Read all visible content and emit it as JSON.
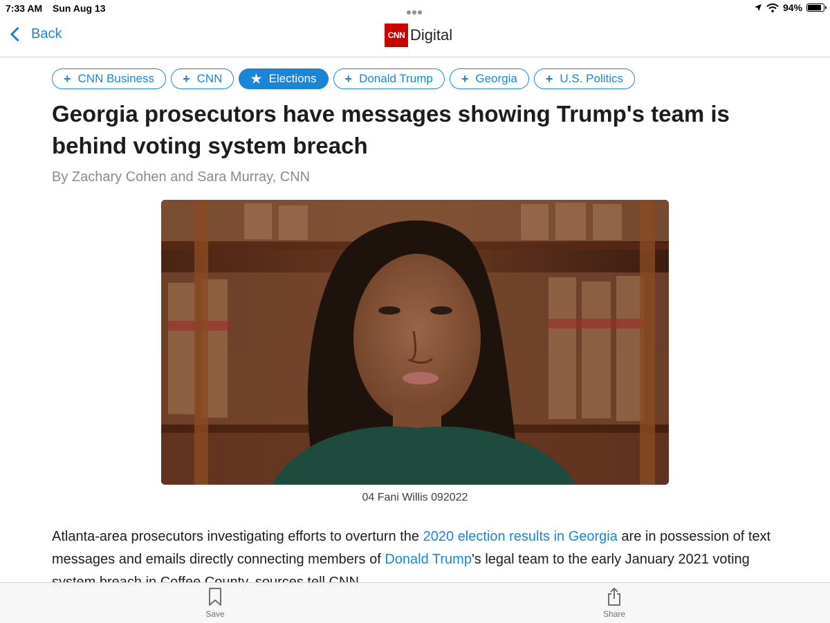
{
  "status_bar": {
    "time": "7:33 AM",
    "date": "Sun Aug 13",
    "battery": "94%",
    "battery_level": 0.94
  },
  "nav": {
    "back_label": "Back",
    "logo_mark": "CNN",
    "logo_text": "Digital"
  },
  "tags": [
    {
      "label": "CNN Business",
      "icon": "plus-icon",
      "active": false
    },
    {
      "label": "CNN",
      "icon": "plus-icon",
      "active": false
    },
    {
      "label": "Elections",
      "icon": "star-icon",
      "active": true
    },
    {
      "label": "Donald Trump",
      "icon": "plus-icon",
      "active": false
    },
    {
      "label": "Georgia",
      "icon": "plus-icon",
      "active": false
    },
    {
      "label": "U.S. Politics",
      "icon": "plus-icon",
      "active": false
    }
  ],
  "article": {
    "headline": "Georgia prosecutors have messages showing Trump's team is behind voting system breach",
    "byline": "By Zachary Cohen and Sara Murray, CNN",
    "photo_caption": "04 Fani Willis 092022",
    "paragraph": {
      "t1": "Atlanta-area prosecutors investigating efforts to overturn the ",
      "link1": "2020 election results in Georgia",
      "t2": " are in possession of text messages and emails directly connecting members of ",
      "link2": "Donald Trump",
      "t3": "'s legal team to the early January 2021 voting system breach in Coffee County, sources tell CNN."
    }
  },
  "toolbar": {
    "save_label": "Save",
    "share_label": "Share"
  },
  "colors": {
    "accent": "#1a84d8",
    "cnn_red": "#cc0000"
  }
}
